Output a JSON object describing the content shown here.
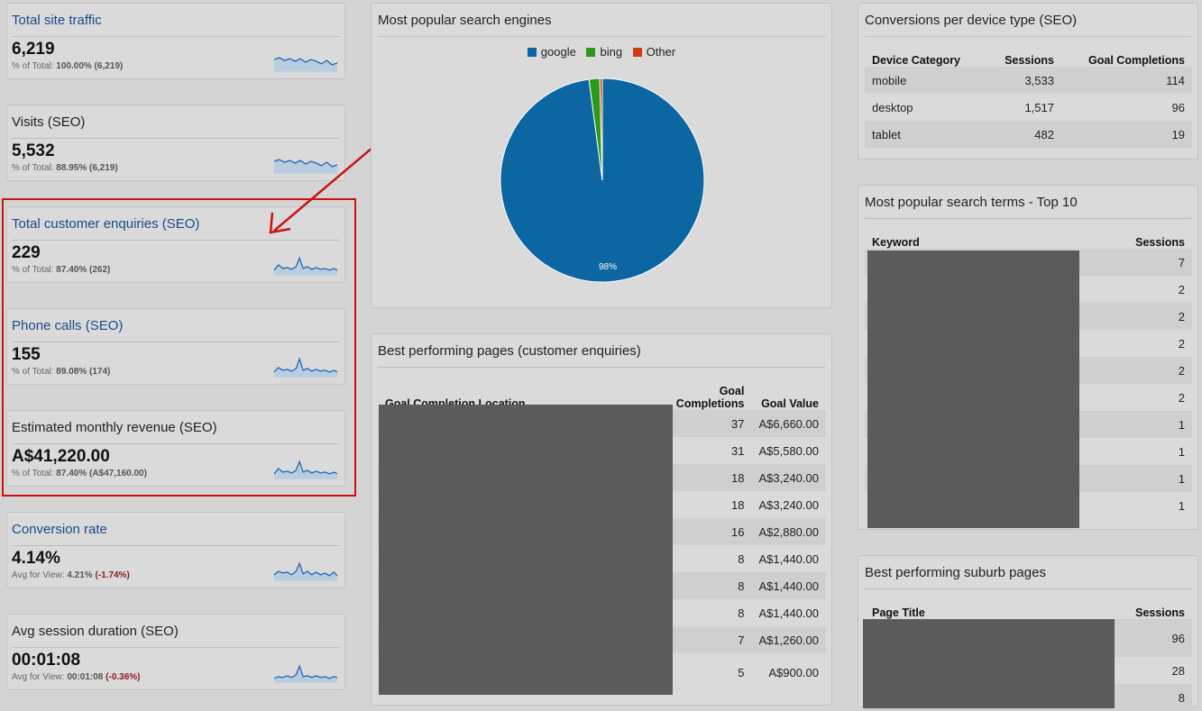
{
  "metrics": [
    {
      "title": "Total site traffic",
      "value": "6,219",
      "foot_label": "% of Total:",
      "foot_value": "100.00% (6,219)",
      "foot_change": "",
      "title_color": "link"
    },
    {
      "title": "Visits (SEO)",
      "value": "5,532",
      "foot_label": "% of Total:",
      "foot_value": "88.95% (6,219)",
      "foot_change": "",
      "title_color": "dark"
    },
    {
      "title": "Total customer enquiries (SEO)",
      "value": "229",
      "foot_label": "% of Total:",
      "foot_value": "87.40% (262)",
      "foot_change": "",
      "title_color": "link"
    },
    {
      "title": "Phone calls (SEO)",
      "value": "155",
      "foot_label": "% of Total:",
      "foot_value": "89.08% (174)",
      "foot_change": "",
      "title_color": "link"
    },
    {
      "title": "Estimated monthly revenue (SEO)",
      "value": "A$41,220.00",
      "foot_label": "% of Total:",
      "foot_value": "87.40% (A$47,160.00)",
      "foot_change": "",
      "title_color": "dark"
    },
    {
      "title": "Conversion rate",
      "value": "4.14%",
      "foot_label": "Avg for View:",
      "foot_value": "4.21%",
      "foot_change": "(-1.74%)",
      "title_color": "link"
    },
    {
      "title": "Avg session duration (SEO)",
      "value": "00:01:08",
      "foot_label": "Avg for View:",
      "foot_value": "00:01:08",
      "foot_change": "(-0.36%)",
      "title_color": "dark"
    }
  ],
  "search_engines": {
    "title": "Most popular search engines",
    "legend": [
      "google",
      "bing",
      "Other"
    ],
    "slice_label": "98%",
    "chart_data": {
      "type": "pie",
      "categories": [
        "google",
        "bing",
        "Other"
      ],
      "values": [
        97.9,
        1.7,
        0.4
      ],
      "colors": [
        "#0b66a2",
        "#2b9a1a",
        "#d23a10"
      ]
    }
  },
  "best_pages": {
    "title": "Best performing pages (customer enquiries)",
    "headers": [
      "Goal Completion Location",
      "Goal Completions",
      "Goal Value"
    ],
    "rows": [
      {
        "completions": "37",
        "value": "A$6,660.00"
      },
      {
        "completions": "31",
        "value": "A$5,580.00"
      },
      {
        "completions": "18",
        "value": "A$3,240.00"
      },
      {
        "completions": "18",
        "value": "A$3,240.00"
      },
      {
        "completions": "16",
        "value": "A$2,880.00"
      },
      {
        "completions": "8",
        "value": "A$1,440.00"
      },
      {
        "completions": "8",
        "value": "A$1,440.00"
      },
      {
        "completions": "8",
        "value": "A$1,440.00"
      },
      {
        "completions": "7",
        "value": "A$1,260.00"
      },
      {
        "completions": "5",
        "value": "A$900.00"
      }
    ]
  },
  "device": {
    "title": "Conversions per device type (SEO)",
    "headers": [
      "Device Category",
      "Sessions",
      "Goal Completions"
    ],
    "rows": [
      {
        "category": "mobile",
        "sessions": "3,533",
        "goals": "114"
      },
      {
        "category": "desktop",
        "sessions": "1,517",
        "goals": "96"
      },
      {
        "category": "tablet",
        "sessions": "482",
        "goals": "19"
      }
    ]
  },
  "search_terms": {
    "title": "Most popular search terms - Top 10",
    "headers": [
      "Keyword",
      "Sessions"
    ],
    "rows": [
      "7",
      "2",
      "2",
      "2",
      "2",
      "2",
      "1",
      "1",
      "1",
      "1"
    ]
  },
  "suburb_pages": {
    "title": "Best performing suburb pages",
    "headers": [
      "Page Title",
      "Sessions"
    ],
    "rows": [
      "96",
      "28",
      "8"
    ]
  },
  "colors": {
    "accent": "#1a4a8a",
    "highlight": "#cc1111",
    "spark_line": "#1e64b4",
    "spark_fill": "#b8cde0"
  }
}
